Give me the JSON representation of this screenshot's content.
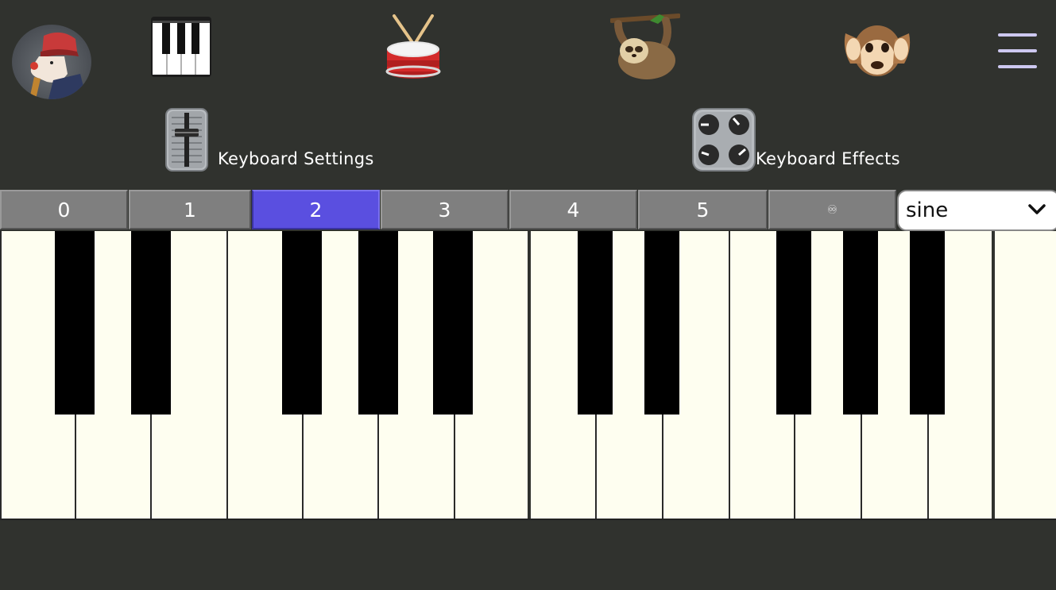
{
  "nav": {
    "items": [
      {
        "name": "piano",
        "icon": "piano-keyboard-icon"
      },
      {
        "name": "drum",
        "icon": "drum-icon"
      },
      {
        "name": "sloth",
        "icon": "sloth-icon"
      },
      {
        "name": "monkey",
        "icon": "hear-no-evil-monkey-icon"
      }
    ],
    "menu_icon": "hamburger-menu-icon"
  },
  "settings": {
    "keyboard_settings_label": "Keyboard Settings",
    "keyboard_effects_label": "Keyboard Effects"
  },
  "octaves": {
    "options": [
      "0",
      "1",
      "2",
      "3",
      "4",
      "5",
      "♾"
    ],
    "selected": "2"
  },
  "waveform": {
    "selected": "sine"
  },
  "colors": {
    "background": "#30322e",
    "active_octave": "#5a4fe0",
    "octave_button": "#7f7f7f",
    "white_key": "#fefef0",
    "black_key": "#000000",
    "menu_icon": "#cdc8f0"
  }
}
